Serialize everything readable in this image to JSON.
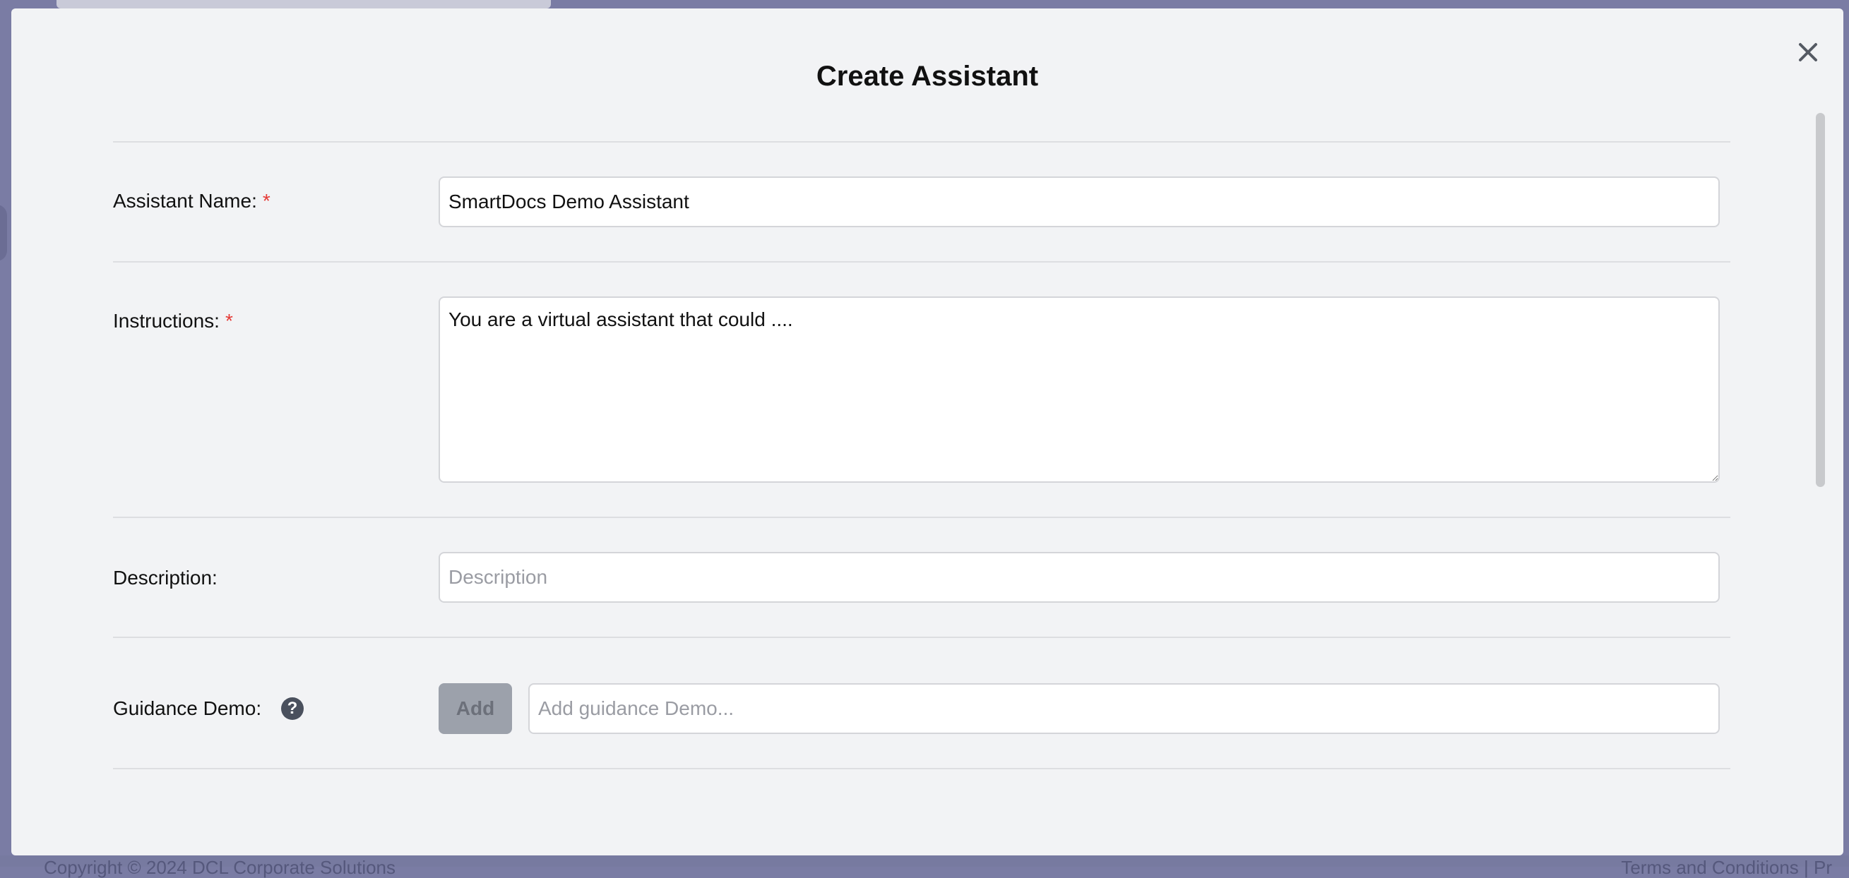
{
  "background": {
    "footer_left": "Copyright © 2024 DCL Corporate Solutions",
    "footer_right": "Terms and Conditions | Pr"
  },
  "modal": {
    "title": "Create Assistant",
    "close_icon": "close-icon",
    "fields": {
      "assistant_name": {
        "label": "Assistant Name:",
        "required_mark": "*",
        "value": "SmartDocs Demo Assistant"
      },
      "instructions": {
        "label": "Instructions:",
        "required_mark": "*",
        "value": "You are a virtual assistant that could ...."
      },
      "description": {
        "label": "Description:",
        "placeholder": "Description",
        "value": ""
      },
      "guidance_demo": {
        "label": "Guidance Demo:",
        "help_icon": "question-circle-icon",
        "help_glyph": "?",
        "add_label": "Add",
        "placeholder": "Add guidance Demo..."
      }
    }
  },
  "colors": {
    "overlay": "#7a7ca4",
    "modal_bg": "#f2f3f5",
    "required": "#e53935",
    "add_button_disabled": "#9ca1ab"
  }
}
